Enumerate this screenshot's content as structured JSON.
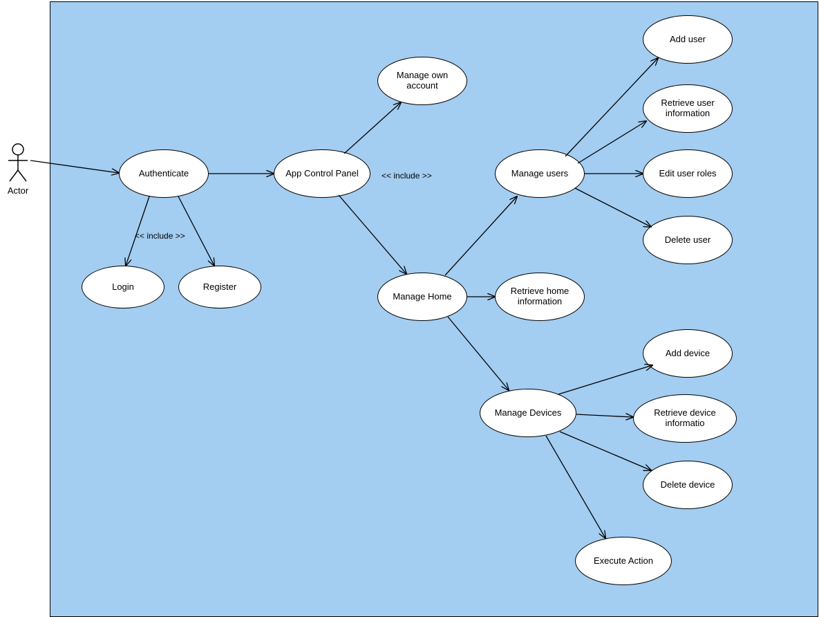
{
  "actor": {
    "label": "Actor"
  },
  "includes": {
    "auth": "<< include >>",
    "panel": "<< include >>"
  },
  "usecases": {
    "authenticate": "Authenticate",
    "login": "Login",
    "register": "Register",
    "app_control_panel": "App Control Panel",
    "manage_own_account": "Manage own account",
    "manage_home": "Manage Home",
    "retrieve_home_info": "Retrieve home information",
    "manage_users": "Manage users",
    "add_user": "Add user",
    "retrieve_user_info": "Retrieve user information",
    "edit_user_roles": "Edit user roles",
    "delete_user": "Delete user",
    "manage_devices": "Manage Devices",
    "add_device": "Add device",
    "retrieve_device_info": "Retrieve device informatio",
    "delete_device": "Delete device",
    "execute_action": "Execute Action"
  },
  "edges": [
    {
      "from": "actor",
      "to": "authenticate"
    },
    {
      "from": "authenticate",
      "to": "login",
      "label": "<< include >>"
    },
    {
      "from": "authenticate",
      "to": "register",
      "label": "<< include >>"
    },
    {
      "from": "authenticate",
      "to": "app_control_panel"
    },
    {
      "from": "app_control_panel",
      "to": "manage_own_account"
    },
    {
      "from": "app_control_panel",
      "to": "manage_home",
      "label": "<< include >>"
    },
    {
      "from": "manage_home",
      "to": "retrieve_home_info"
    },
    {
      "from": "manage_home",
      "to": "manage_users"
    },
    {
      "from": "manage_home",
      "to": "manage_devices"
    },
    {
      "from": "manage_users",
      "to": "add_user"
    },
    {
      "from": "manage_users",
      "to": "retrieve_user_info"
    },
    {
      "from": "manage_users",
      "to": "edit_user_roles"
    },
    {
      "from": "manage_users",
      "to": "delete_user"
    },
    {
      "from": "manage_devices",
      "to": "add_device"
    },
    {
      "from": "manage_devices",
      "to": "retrieve_device_info"
    },
    {
      "from": "manage_devices",
      "to": "delete_device"
    },
    {
      "from": "manage_devices",
      "to": "execute_action"
    }
  ]
}
